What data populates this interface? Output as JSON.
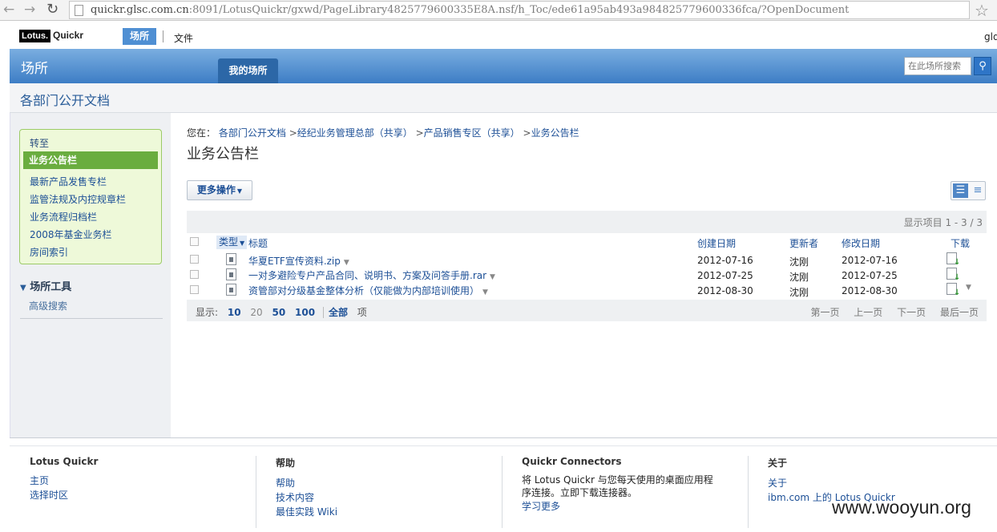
{
  "browser": {
    "url_host": "quickr.glsc.com.cn",
    "url_rest": ":8091/LotusQuickr/gxwd/PageLibrary4825779600335E8A.nsf/h_Toc/ede61a95ab493a984825779600336fca/?OpenDocument"
  },
  "topbar": {
    "logo_lotus": "Lotus.",
    "logo_quickr": "Quickr",
    "nav_places": "场所",
    "nav_files": "文件",
    "user": "glq"
  },
  "header": {
    "title": "场所",
    "tab_my_places": "我的场所",
    "search_placeholder": "在此场所搜索"
  },
  "place": {
    "title": "各部门公开文档"
  },
  "sidebar": {
    "goto_label": "转至",
    "active_item": "业务公告栏",
    "items": [
      "最新产品发售专栏",
      "监管法规及内控规章栏",
      "业务流程归档栏",
      "2008年基金业务栏",
      "房间索引"
    ],
    "tools_label": "场所工具",
    "tools_link": "高级搜索"
  },
  "breadcrumb": {
    "lead": "您在：",
    "items": [
      "各部门公开文档",
      "经纪业务管理总部（共享）",
      "产品销售专区（共享）",
      "业务公告栏"
    ]
  },
  "main": {
    "page_title": "业务公告栏",
    "more_actions": "更多操作",
    "count_text": "显示项目 1 - 3 / 3"
  },
  "table": {
    "headers": {
      "type": "类型",
      "title": "标题",
      "created": "创建日期",
      "updater": "更新者",
      "modified": "修改日期",
      "download": "下载"
    },
    "rows": [
      {
        "title": "华夏ETF宣传资料.zip",
        "created": "2012-07-16",
        "updater": "沈刚",
        "modified": "2012-07-16"
      },
      {
        "title": "一对多避险专户产品合同、说明书、方案及问答手册.rar",
        "created": "2012-07-25",
        "updater": "沈刚",
        "modified": "2012-07-25"
      },
      {
        "title": "资管部对分级基金整体分析（仅能做为内部培训使用）",
        "created": "2012-08-30",
        "updater": "沈刚",
        "modified": "2012-08-30"
      }
    ]
  },
  "pager": {
    "show_label": "显示:",
    "sizes": [
      "10",
      "20",
      "50",
      "100"
    ],
    "all": "全部",
    "unit": "项",
    "first": "第一页",
    "prev": "上一页",
    "next": "下一页",
    "last": "最后一页"
  },
  "footer": {
    "col1": {
      "heading": "Lotus Quickr",
      "links": [
        "主页",
        "选择时区"
      ]
    },
    "col2": {
      "heading": "帮助",
      "links": [
        "帮助",
        "技术内容",
        "最佳实践 Wiki"
      ]
    },
    "col3": {
      "heading": "Quickr Connectors",
      "text1": "将 Lotus Quickr 与您每天使用的桌面应用程",
      "text2": "序连接。立即下载连接器。",
      "link": "学习更多"
    },
    "col4": {
      "heading": "关于",
      "links": [
        "关于",
        "ibm.com 上的 Lotus Quickr"
      ]
    }
  },
  "watermark": "www.wooyun.org"
}
